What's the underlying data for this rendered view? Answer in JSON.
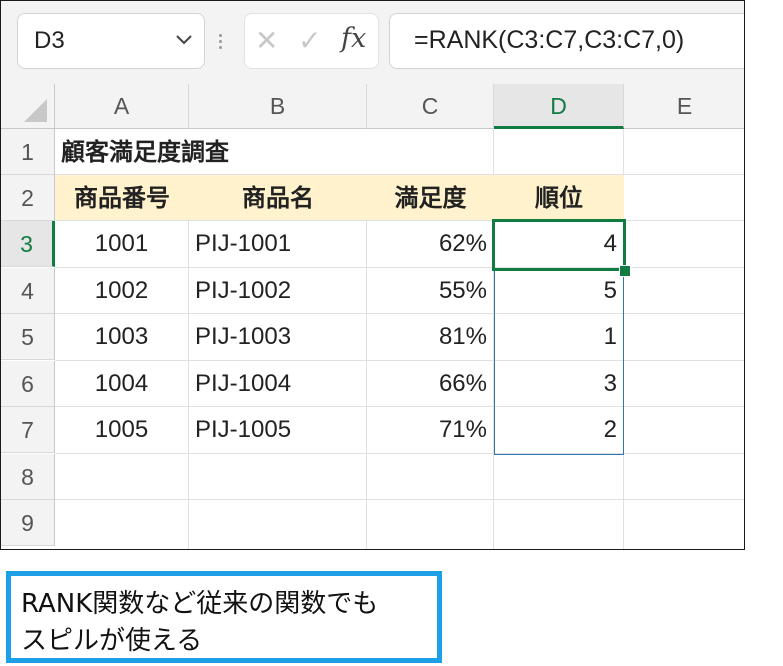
{
  "name_box": {
    "value": "D3"
  },
  "formula_bar": {
    "fx_label": "fx",
    "cancel_glyph": "✕",
    "enter_glyph": "✓",
    "formula": "=RANK(C3:C7,C3:C7,0)"
  },
  "columns": [
    "A",
    "B",
    "C",
    "D",
    "E"
  ],
  "rows": [
    "1",
    "2",
    "3",
    "4",
    "5",
    "6",
    "7",
    "8",
    "9"
  ],
  "active": {
    "column": "D",
    "row": "3"
  },
  "sheet": {
    "title": "顧客満足度調査",
    "headers": [
      "商品番号",
      "商品名",
      "満足度",
      "順位"
    ],
    "records": [
      {
        "id": "1001",
        "name": "PIJ-1001",
        "satisfaction": "62%",
        "rank": "4"
      },
      {
        "id": "1002",
        "name": "PIJ-1002",
        "satisfaction": "55%",
        "rank": "5"
      },
      {
        "id": "1003",
        "name": "PIJ-1003",
        "satisfaction": "81%",
        "rank": "1"
      },
      {
        "id": "1004",
        "name": "PIJ-1004",
        "satisfaction": "66%",
        "rank": "3"
      },
      {
        "id": "1005",
        "name": "PIJ-1005",
        "satisfaction": "71%",
        "rank": "2"
      }
    ]
  },
  "callout": {
    "line1": "RANK関数など従来の関数でも",
    "line2": "スピルが使える"
  },
  "colors": {
    "accent_green": "#107c41",
    "spill_blue": "#2e75b6",
    "header_fill": "#fff2cc",
    "callout_border": "#1ea0e6"
  }
}
